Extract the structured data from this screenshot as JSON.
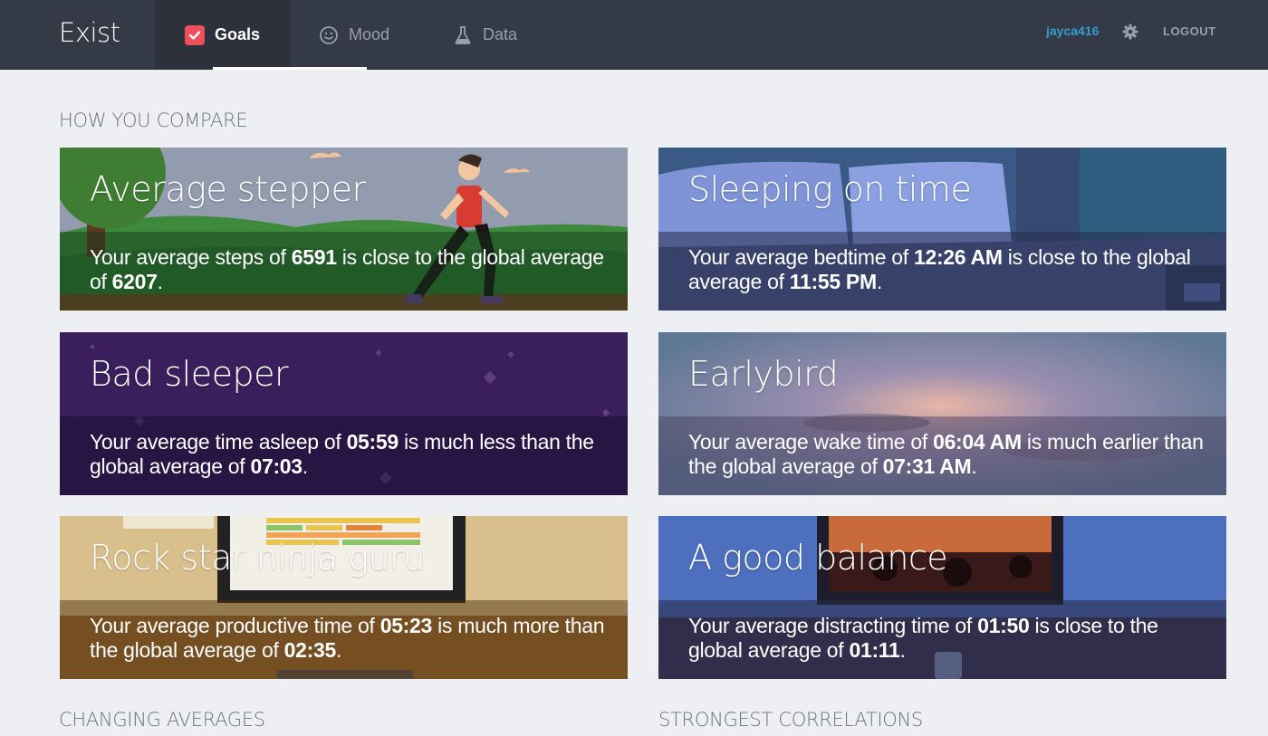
{
  "app": {
    "name": "Exist"
  },
  "nav": {
    "tabs": [
      {
        "label": "Goals",
        "icon": "checkbox-icon",
        "active": true
      },
      {
        "label": "Mood",
        "icon": "smiley-icon",
        "active": false
      },
      {
        "label": "Data",
        "icon": "flask-icon",
        "active": false
      }
    ],
    "username": "jayca416",
    "logout_label": "LOGOUT"
  },
  "sections": {
    "how_you_compare": "HOW YOU COMPARE",
    "changing_averages": "CHANGING AVERAGES",
    "strongest_correlations": "STRONGEST CORRELATIONS"
  },
  "cards": [
    {
      "title": "Average stepper",
      "text_before": "Your average steps of ",
      "value": "6591",
      "text_middle": " is close to the global average of ",
      "global": "6207",
      "text_after": "."
    },
    {
      "title": "Sleeping on time",
      "text_before": "Your average bedtime of ",
      "value": "12:26 AM",
      "text_middle": " is close to the global average of ",
      "global": "11:55 PM",
      "text_after": "."
    },
    {
      "title": "Bad sleeper",
      "text_before": "Your average time asleep of ",
      "value": "05:59",
      "text_middle": " is much less than the global average of ",
      "global": "07:03",
      "text_after": "."
    },
    {
      "title": "Earlybird",
      "text_before": "Your average wake time of ",
      "value": "06:04 AM",
      "text_middle": " is much earlier than the global average of ",
      "global": "07:31 AM",
      "text_after": "."
    },
    {
      "title": "Rock star ninja guru",
      "text_before": "Your average productive time of ",
      "value": "05:23",
      "text_middle": " is much more than the global average of ",
      "global": "02:35",
      "text_after": "."
    },
    {
      "title": "A good balance",
      "text_before": "Your average distracting time of ",
      "value": "01:50",
      "text_middle": " is close to the global average of ",
      "global": "01:11",
      "text_after": "."
    }
  ],
  "colors": {
    "nav_bg": "#353b46",
    "accent_red": "#ef4f5a",
    "link_blue": "#2f9fd0",
    "page_bg": "#eeeff3"
  }
}
